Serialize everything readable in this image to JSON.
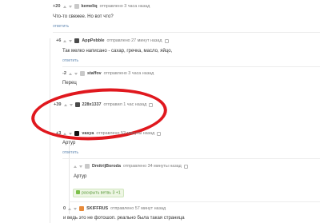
{
  "comments": [
    {
      "score": "+20",
      "user": "kemeliq",
      "time": "отправлено 3 часа назад",
      "text": "Что-то свежее. Но вот что?",
      "reply": "ответить"
    },
    {
      "score": "+6",
      "user": "AppPebble",
      "time": "отправлено 27 минут назад",
      "text": "Так мелко написано - сахар, гречка, масло, яйцо,",
      "reply": "ответить"
    },
    {
      "score": "-2",
      "user": "staffov",
      "time": "отправлено 3 часа назад",
      "text": "Перец"
    },
    {
      "score": "+39",
      "user": "228x1337",
      "time": "отправил 1 час назад"
    },
    {
      "score": "+3",
      "user": "vasya",
      "time": "отправлено 52 минуты назад",
      "text": "Артур",
      "reply": "ответить"
    },
    {
      "score": "",
      "user": "DmitrijBoroda",
      "time": "отправлено 34 минуты назад",
      "text": "Артур",
      "expand": "раскрыть ветвь 3 +1"
    },
    {
      "score": "0",
      "user": "SKIFFRUS",
      "time": "отправлено 57 минут назад",
      "text": "и ведь это не фотошоп. реально была такая страница",
      "reply": "ответить"
    }
  ],
  "colors": {
    "highlight_circle": "#e0181e",
    "link": "#6a8fb6",
    "expand": "#5a9a3a"
  }
}
